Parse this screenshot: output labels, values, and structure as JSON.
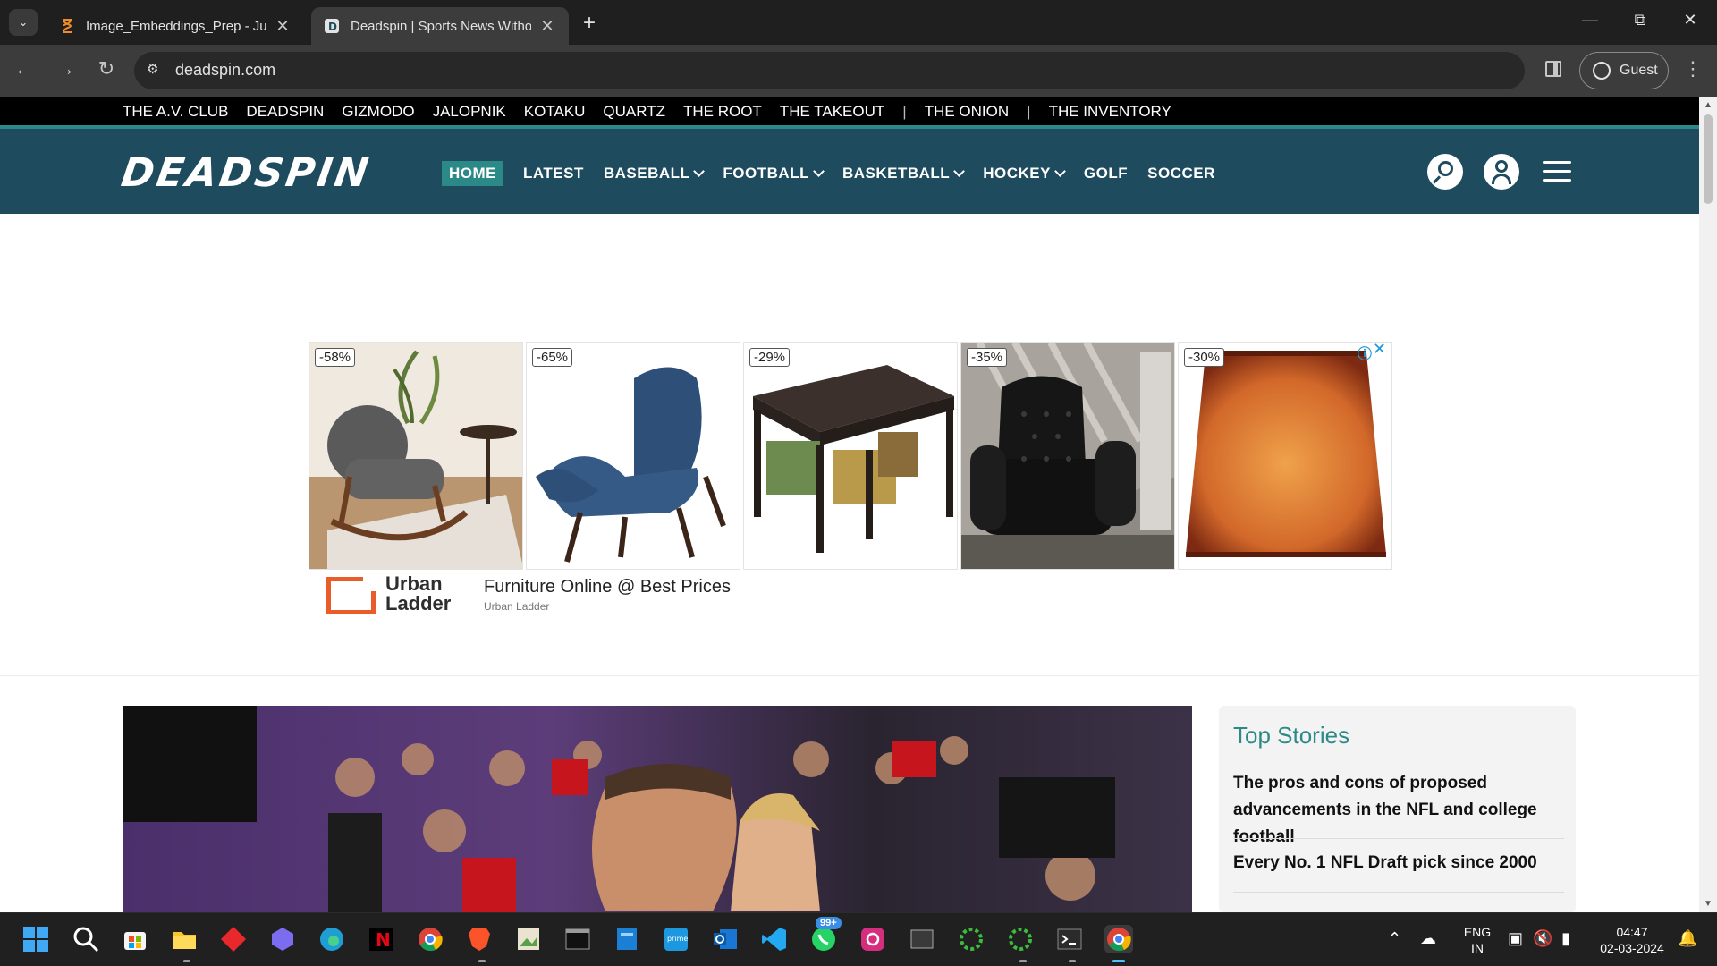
{
  "browser": {
    "tabs": [
      {
        "title": "Image_Embeddings_Prep - Jupyter",
        "favicon": "hourglass-icon",
        "active": false
      },
      {
        "title": "Deadspin | Sports News Without Fear",
        "favicon": "deadspin-favicon",
        "active": true
      }
    ],
    "new_tab": "+",
    "url": "deadspin.com",
    "profile_label": "Guest"
  },
  "network_links": [
    "THE A.V. CLUB",
    "DEADSPIN",
    "GIZMODO",
    "JALOPNIK",
    "KOTAKU",
    "QUARTZ",
    "THE ROOT",
    "THE TAKEOUT",
    "THE ONION",
    "THE INVENTORY"
  ],
  "header": {
    "logo": "DEADSPIN",
    "nav": [
      {
        "label": "HOME",
        "active": true,
        "dropdown": false
      },
      {
        "label": "LATEST",
        "active": false,
        "dropdown": false
      },
      {
        "label": "BASEBALL",
        "active": false,
        "dropdown": true
      },
      {
        "label": "FOOTBALL",
        "active": false,
        "dropdown": true
      },
      {
        "label": "BASKETBALL",
        "active": false,
        "dropdown": true
      },
      {
        "label": "HOCKEY",
        "active": false,
        "dropdown": true
      },
      {
        "label": "GOLF",
        "active": false,
        "dropdown": false
      },
      {
        "label": "SOCCER",
        "active": false,
        "dropdown": false
      }
    ]
  },
  "ad": {
    "products": [
      {
        "discount": "-58%",
        "item": "rocking chair"
      },
      {
        "discount": "-65%",
        "item": "wing chair with ottoman"
      },
      {
        "discount": "-29%",
        "item": "coffee table with stools"
      },
      {
        "discount": "-35%",
        "item": "tufted leather armchair"
      },
      {
        "discount": "-30%",
        "item": "lamp shade"
      }
    ],
    "brand_line1": "Urban",
    "brand_line2": "Ladder",
    "headline": "Furniture Online @ Best Prices",
    "advertiser": "Urban Ladder"
  },
  "top_stories": {
    "title": "Top Stories",
    "items": [
      "The pros and cons of proposed advancements in the NFL and college football",
      "Every No. 1 NFL Draft pick since 2000"
    ]
  },
  "taskbar": {
    "whatsapp_badge": "99+",
    "lang_line1": "ENG",
    "lang_line2": "IN",
    "time": "04:47",
    "date": "02-03-2024"
  },
  "colors": {
    "brand_teal": "#2b8a88",
    "header_bg": "#1e4b5e",
    "top_stories_title": "#2b8a88",
    "urban_ladder_orange": "#e85d2a"
  }
}
